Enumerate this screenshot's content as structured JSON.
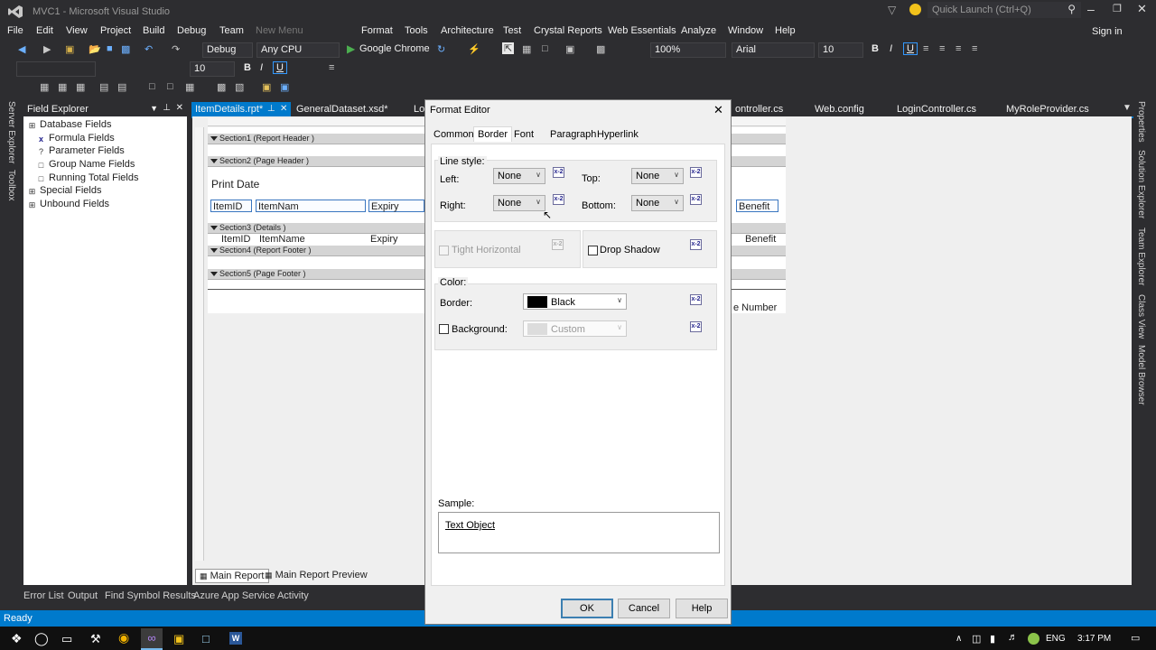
{
  "window": {
    "title": "MVC1 - Microsoft Visual Studio",
    "quick_launch": "Quick Launch (Ctrl+Q)",
    "sign_in": "Sign in"
  },
  "menu": [
    "File",
    "Edit",
    "View",
    "Project",
    "Build",
    "Debug",
    "Team",
    "New Menu",
    "Format",
    "Tools",
    "Architecture",
    "Test",
    "Crystal Reports",
    "Web Essentials",
    "Analyze",
    "Window",
    "Help"
  ],
  "toolbar": {
    "config": "Debug",
    "platform": "Any CPU",
    "run_target": "Google Chrome",
    "zoom": "100%",
    "font": "Arial",
    "font_size": "10",
    "font_size2": "10",
    "bold": "B",
    "italic": "I",
    "underline": "U"
  },
  "side_tabs_left": [
    "Server Explorer",
    "Toolbox"
  ],
  "side_tabs_right": [
    "Properties",
    "Solution Explorer",
    "Team Explorer",
    "Class View",
    "Model Browser"
  ],
  "field_explorer": {
    "title": "Field Explorer",
    "items": [
      "Database Fields",
      "Formula Fields",
      "Parameter Fields",
      "Group Name Fields",
      "Running Total Fields",
      "Special Fields",
      "Unbound Fields"
    ]
  },
  "doc_tabs": [
    "ItemDetails.rpt*",
    "GeneralDataset.xsd*",
    "Lo",
    "ontroller.cs",
    "Web.config",
    "LoginController.cs",
    "MyRoleProvider.cs"
  ],
  "sections": [
    "Section1 (Report Header )",
    "Section2 (Page Header )",
    "Section3 (Details )",
    "Section4 (Report Footer )",
    "Section5 (Page Footer )"
  ],
  "report_fields": {
    "print_date": "Print Date",
    "h_itemid": "ItemID",
    "h_itemname": "ItemNam",
    "h_expiry": "Expiry",
    "h_benefit": "Benefit",
    "d_itemid": "ItemID",
    "d_itemname": "ItemName",
    "d_expiry": "Expiry",
    "d_benefit": "Benefit",
    "page_number": "e Number"
  },
  "report_tabs": [
    "Main Report",
    "Main Report Preview"
  ],
  "bottom_tabs": [
    "Error List",
    "Output",
    "Find Symbol Results",
    "Azure App Service Activity"
  ],
  "status": "Ready",
  "dialog": {
    "title": "Format Editor",
    "tabs": [
      "Common",
      "Border",
      "Font",
      "Paragraph",
      "Hyperlink"
    ],
    "line_style_label": "Line style:",
    "left_label": "Left:",
    "left_value": "None",
    "right_label": "Right:",
    "right_value": "None",
    "top_label": "Top:",
    "top_value": "None",
    "bottom_label": "Bottom:",
    "bottom_value": "None",
    "tight_horizontal": "Tight Horizontal",
    "drop_shadow": "Drop Shadow",
    "color_label": "Color:",
    "border_label": "Border:",
    "border_color": "Black",
    "background_label": "Background:",
    "background_color": "Custom",
    "sample_label": "Sample:",
    "sample_text": "Text Object",
    "ok": "OK",
    "cancel": "Cancel",
    "help": "Help",
    "formula_button": "x-2"
  },
  "taskbar": {
    "lang": "ENG",
    "time": "3:17 PM"
  },
  "colors": {
    "accent": "#007acc",
    "bg": "#2d2d30"
  }
}
